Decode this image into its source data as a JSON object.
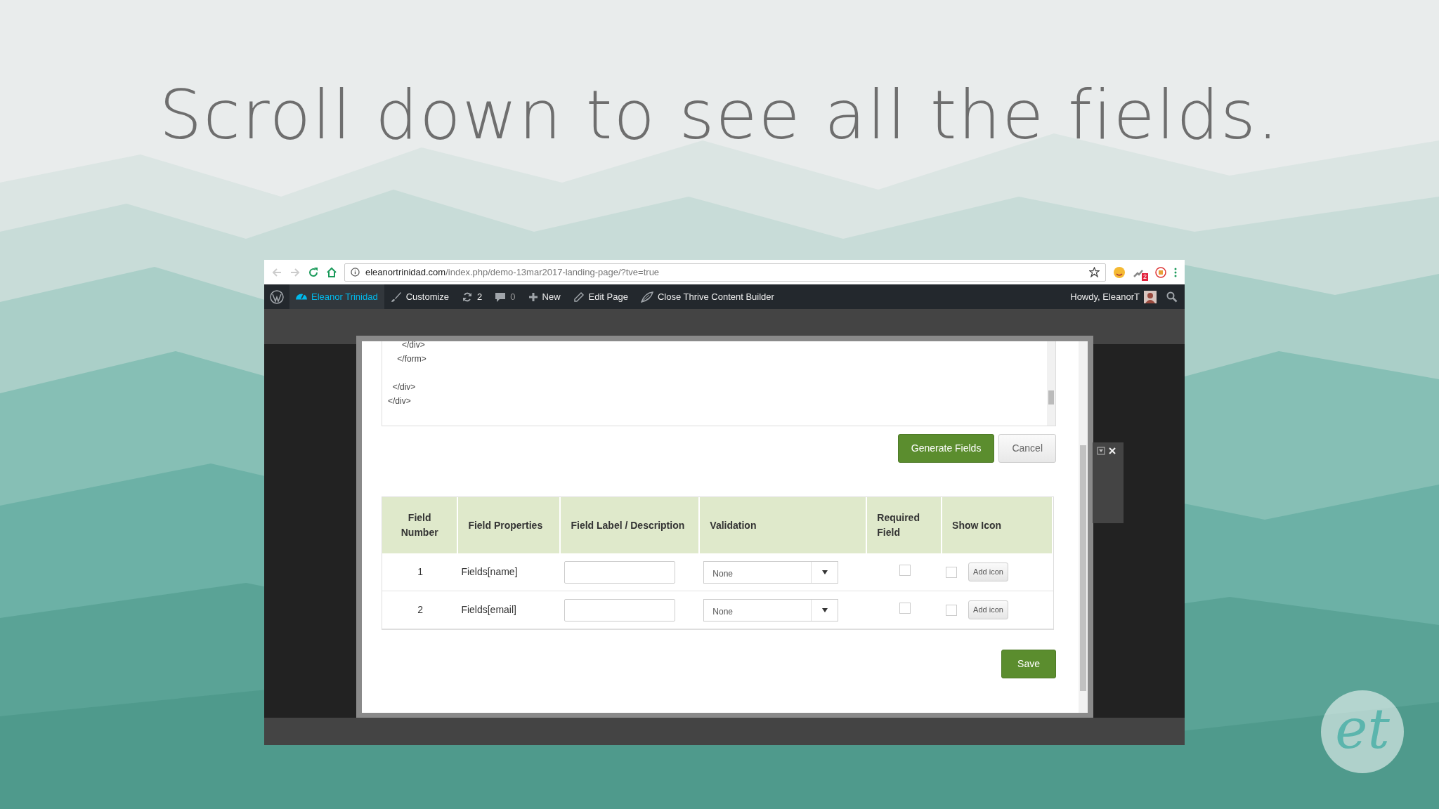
{
  "slide": {
    "title": "Scroll down to see all the fields.",
    "logo": "et"
  },
  "browser": {
    "address_domain": "eleanortrinidad.com",
    "address_path": "/index.php/demo-13mar2017-landing-page/?tve=true",
    "extension_badge": "2"
  },
  "admin_bar": {
    "items": [
      {
        "kind": "wp"
      },
      {
        "kind": "site",
        "label": "Eleanor Trinidad",
        "selected": true
      },
      {
        "kind": "customize",
        "label": "Customize",
        "selected": false
      },
      {
        "kind": "updates",
        "label": "2",
        "selected": false
      },
      {
        "kind": "comments",
        "label": "0",
        "selected": false
      },
      {
        "kind": "new",
        "label": "New",
        "selected": false
      },
      {
        "kind": "edit",
        "label": "Edit Page",
        "selected": false
      },
      {
        "kind": "thrive",
        "label": "Close Thrive Content Builder",
        "selected": false
      }
    ],
    "greeting": "Howdy, EleanorT"
  },
  "editor": {
    "code": "      </div>\n    </form>\n\n  </div>\n</div>"
  },
  "actions": [
    "Generate Fields",
    "Cancel"
  ],
  "table": {
    "columns": [
      "Field Number",
      "Field Properties",
      "Field Label / Description",
      "Validation",
      "Required Field",
      "Show Icon"
    ],
    "rows": [
      {
        "number": "1",
        "property": "Fields[name]",
        "validation": "None",
        "required": false,
        "show_icon": false,
        "button": "Add icon"
      },
      {
        "number": "2",
        "property": "Fields[email]",
        "validation": "None",
        "required": false,
        "show_icon": false,
        "button": "Add icon"
      }
    ]
  },
  "save": "Save"
}
